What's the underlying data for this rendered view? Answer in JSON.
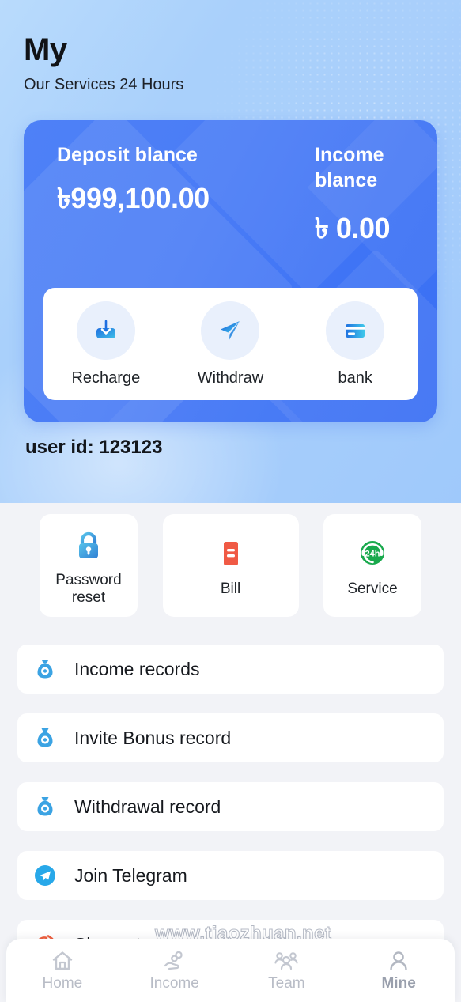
{
  "header": {
    "title": "My",
    "subtitle": "Our Services 24 Hours",
    "user_id": "user id: 123123"
  },
  "balance_card": {
    "deposit_label": "Deposit blance",
    "deposit_value": "৳999,100.00",
    "income_label": "Income blance",
    "income_value": "৳ 0.00",
    "actions": [
      {
        "label": "Recharge",
        "icon": "download-arrow-icon"
      },
      {
        "label": "Withdraw",
        "icon": "paper-plane-icon"
      },
      {
        "label": "bank",
        "icon": "bank-card-icon"
      }
    ]
  },
  "quick_actions": [
    {
      "label": "Password reset",
      "icon": "lock-icon",
      "color": "#3f9ae0"
    },
    {
      "label": "Bill",
      "icon": "bill-icon",
      "color": "#f05a45"
    },
    {
      "label": "Service",
      "icon": "service-24h-icon",
      "color": "#19a94d"
    }
  ],
  "menu_items": [
    {
      "label": "Income records",
      "icon": "money-bag-icon"
    },
    {
      "label": "Invite Bonus record",
      "icon": "money-bag-icon"
    },
    {
      "label": "Withdrawal record",
      "icon": "money-bag-icon"
    },
    {
      "label": "Join Telegram",
      "icon": "telegram-icon"
    },
    {
      "label": "Sign out",
      "icon": "sign-out-icon"
    }
  ],
  "watermark": "www.tiaozhuan.net",
  "bottom_nav": [
    {
      "label": "Home",
      "icon": "home-icon",
      "active": false
    },
    {
      "label": "Income",
      "icon": "hand-coin-icon",
      "active": false
    },
    {
      "label": "Team",
      "icon": "team-icon",
      "active": false
    },
    {
      "label": "Mine",
      "icon": "person-icon",
      "active": true
    }
  ],
  "colors": {
    "card_blue": "#4a7cf6",
    "header_blue": "#a9d0fb",
    "page_bg": "#f2f3f7",
    "accent_red": "#f05a45",
    "accent_green": "#19a94d"
  }
}
